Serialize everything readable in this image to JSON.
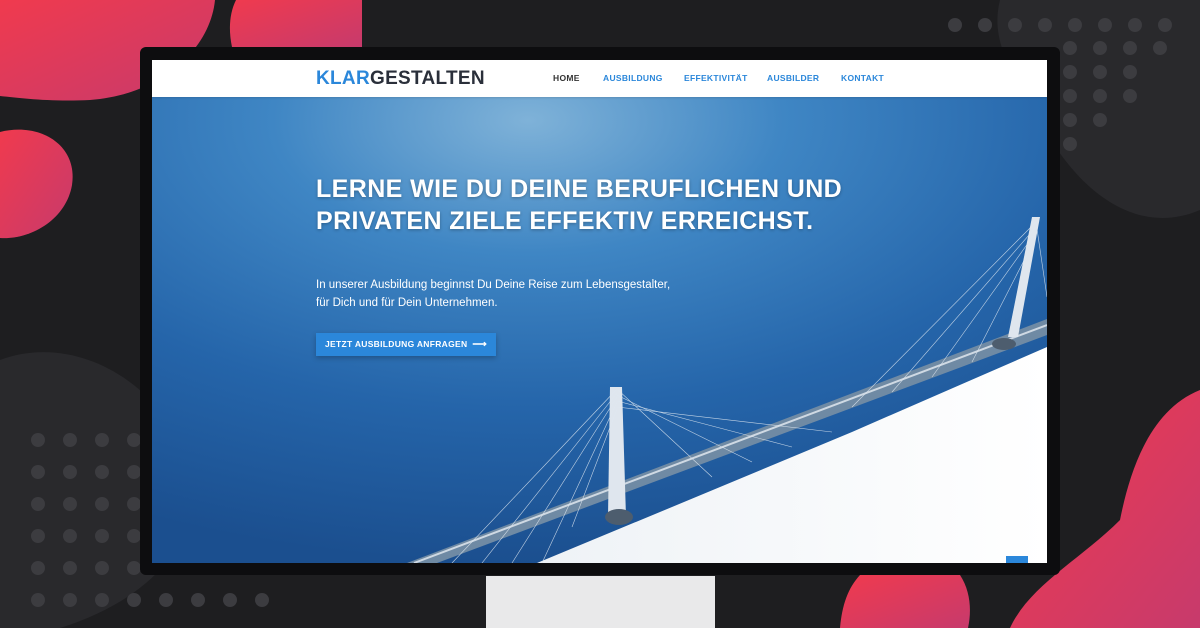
{
  "site": {
    "logo_accent": "KLAR",
    "logo_rest": "GESTALTEN"
  },
  "nav": {
    "items": [
      {
        "label": "HOME",
        "active": true
      },
      {
        "label": "AUSBILDUNG",
        "active": false
      },
      {
        "label": "EFFEKTIVITÄT",
        "active": false
      },
      {
        "label": "AUSBILDER",
        "active": false
      },
      {
        "label": "KONTAKT",
        "active": false
      }
    ]
  },
  "hero": {
    "title": "LERNE WIE DU DEINE BERUFLICHEN UND PRIVATEN ZIELE EFFEKTIV ERREICHST.",
    "subtitle_line1": "In unserer Ausbildung beginnst Du Deine Reise zum Lebensgestalter,",
    "subtitle_line2": "für Dich und für Dein Unternehmen.",
    "cta_label": "JETZT AUSBILDUNG ANFRAGEN",
    "cta_arrow": "⟶",
    "scroll_symbol": "↓"
  },
  "colors": {
    "accent": "#2b87da",
    "nav_active": "#333333",
    "background": "#1e1e20",
    "decor_red": "#e6354f"
  },
  "icons": {
    "cta": "arrow-right-icon",
    "scroll": "arrow-down-icon"
  }
}
